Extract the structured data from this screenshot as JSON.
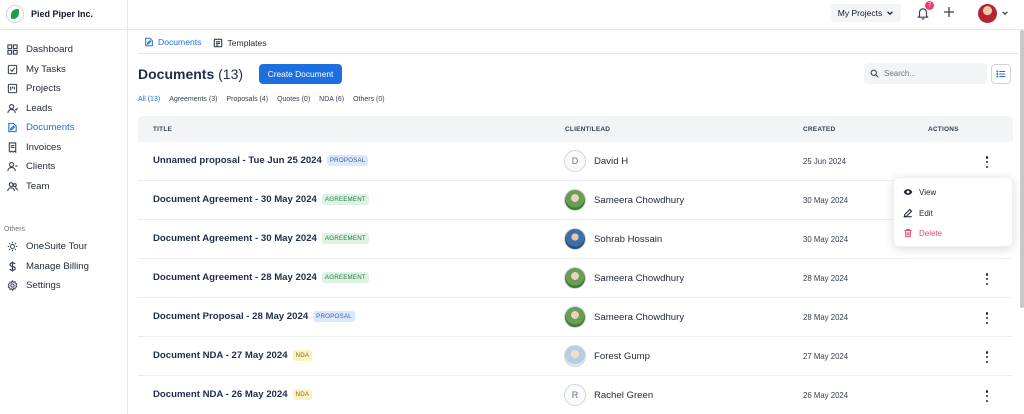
{
  "brand": {
    "name": "Pied Piper Inc."
  },
  "sidebar": {
    "items": [
      {
        "label": "Dashboard",
        "icon": "grid-icon"
      },
      {
        "label": "My Tasks",
        "icon": "tasks-icon"
      },
      {
        "label": "Projects",
        "icon": "projects-icon"
      },
      {
        "label": "Leads",
        "icon": "leads-icon"
      },
      {
        "label": "Documents",
        "icon": "documents-icon",
        "active": true
      },
      {
        "label": "Invoices",
        "icon": "invoices-icon"
      },
      {
        "label": "Clients",
        "icon": "clients-icon"
      },
      {
        "label": "Team",
        "icon": "team-icon"
      }
    ],
    "others_label": "Others",
    "others": [
      {
        "label": "OneSuite Tour",
        "icon": "sun-icon"
      },
      {
        "label": "Manage Billing",
        "icon": "dollar-icon"
      },
      {
        "label": "Settings",
        "icon": "gear-icon"
      }
    ]
  },
  "topbar": {
    "projects_label": "My Projects",
    "notification_count": "7"
  },
  "tabs": [
    {
      "label": "Documents",
      "active": true
    },
    {
      "label": "Templates",
      "active": false
    }
  ],
  "header": {
    "title": "Documents",
    "count": "(13)",
    "create_label": "Create Document",
    "search_placeholder": "Search..."
  },
  "filters": [
    {
      "label": "All (13)",
      "active": true
    },
    {
      "label": "Agreements (3)"
    },
    {
      "label": "Proposals (4)"
    },
    {
      "label": "Quotes (0)"
    },
    {
      "label": "NDA (6)"
    },
    {
      "label": "Others (0)"
    }
  ],
  "table": {
    "columns": [
      "TITLE",
      "CLIENT/LEAD",
      "CREATED",
      "ACTIONS"
    ],
    "rows": [
      {
        "title": "Unnamed proposal - Tue Jun 25 2024",
        "tag": "PROPOSAL",
        "client": "David H",
        "initial": "D",
        "created": "25 Jun 2024"
      },
      {
        "title": "Document Agreement - 30 May 2024",
        "tag": "AGREEMENT",
        "client": "Sameera Chowdhury",
        "initial": "",
        "created": "30 May 2024"
      },
      {
        "title": "Document Agreement - 30 May 2024",
        "tag": "AGREEMENT",
        "client": "Sohrab Hossain",
        "initial": "",
        "created": "30 May 2024"
      },
      {
        "title": "Document Agreement - 28 May 2024",
        "tag": "AGREEMENT",
        "client": "Sameera Chowdhury",
        "initial": "",
        "created": "28 May 2024"
      },
      {
        "title": "Document Proposal - 28 May 2024",
        "tag": "PROPOSAL",
        "client": "Sameera Chowdhury",
        "initial": "",
        "created": "28 May 2024"
      },
      {
        "title": "Document NDA - 27 May 2024",
        "tag": "NDA",
        "client": "Forest Gump",
        "initial": "",
        "created": "27 May 2024"
      },
      {
        "title": "Document NDA - 26 May 2024",
        "tag": "NDA",
        "client": "Rachel Green",
        "initial": "R",
        "created": "26 May 2024"
      }
    ]
  },
  "action_menu": {
    "view_label": "View",
    "edit_label": "Edit",
    "delete_label": "Delete"
  },
  "colors": {
    "accent": "#1d6fe0",
    "danger": "#e14b6f",
    "badge": "#ef3d6a"
  }
}
